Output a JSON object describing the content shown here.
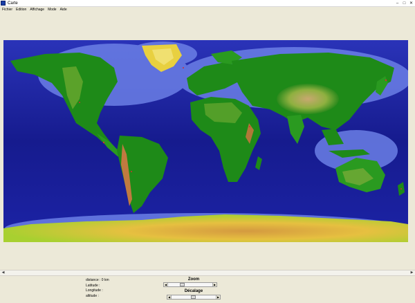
{
  "window": {
    "title": "Carte",
    "minimize_icon": "minimize-icon",
    "maximize_icon": "maximize-icon",
    "close_icon": "close-icon"
  },
  "menu": [
    "Fichier",
    "Edition",
    "Affichage",
    "Mode",
    "Aide"
  ],
  "map": {
    "content": "world elevation map"
  },
  "info": {
    "distance": "distance : 0 km",
    "latitude": "Latitude :",
    "longitude": "Longitude :",
    "altitude": "altitude :"
  },
  "zoom": {
    "label": "Zoom",
    "level": 0.3
  },
  "decalage": {
    "label": "Décalage",
    "level": 0.5
  },
  "colors": {
    "ocean": "#1a1f9a",
    "shelf": "#6b7fe6",
    "land": "#1e8a18",
    "highland": "#b8c830",
    "desert": "#d8a060",
    "ice": "#f0e060"
  }
}
